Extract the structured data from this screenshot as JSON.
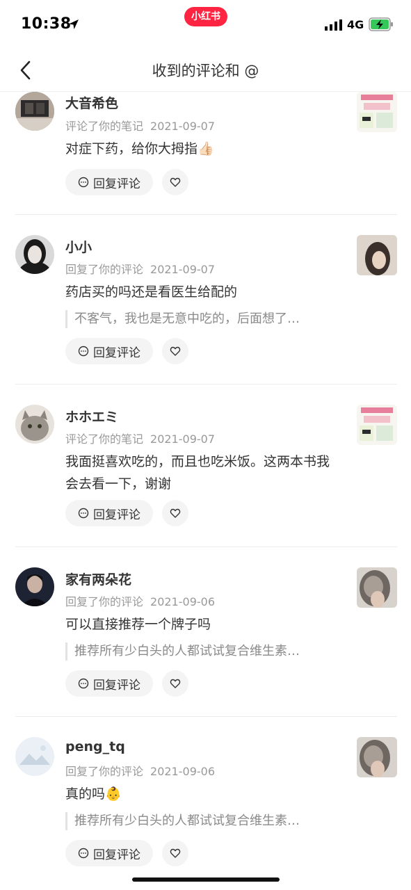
{
  "status_bar": {
    "time": "10:38",
    "network": "4G",
    "brand": "小红书",
    "icons": [
      "location-arrow-icon",
      "signal-icon",
      "battery-charging-icon"
    ]
  },
  "header": {
    "title": "收到的评论和 @",
    "back_icon": "chevron-left-icon"
  },
  "comments": [
    {
      "username": "大音希色",
      "action": "评论了你的笔记",
      "date": "2021-09-07",
      "text": "对症下药，给你大拇指👍🏻",
      "reply_label": "回复评论"
    },
    {
      "username": "小小",
      "action": "回复了你的评论",
      "date": "2021-09-07",
      "text": "药店买的吗还是看医生给配的",
      "quote": "不客气，我也是无意中吃的，后面想了…",
      "reply_label": "回复评论"
    },
    {
      "username": "ホホエミ",
      "action": "评论了你的笔记",
      "date": "2021-09-07",
      "text": "我面挺喜欢吃的，而且也吃米饭。这两本书我会去看一下，谢谢",
      "reply_label": "回复评论"
    },
    {
      "username": "家有两朵花",
      "action": "回复了你的评论",
      "date": "2021-09-06",
      "text": "可以直接推荐一个牌子吗",
      "quote": "推荐所有少白头的人都试试复合维生素…",
      "reply_label": "回复评论"
    },
    {
      "username": "peng_tq",
      "action": "回复了你的评论",
      "date": "2021-09-06",
      "text": "真的吗👶",
      "quote": "推荐所有少白头的人都试试复合维生素…",
      "reply_label": "回复评论"
    }
  ],
  "colors": {
    "brand": "#ff2442",
    "meta_text": "#999999",
    "button_bg": "#f4f4f4",
    "divider": "#ececec"
  }
}
